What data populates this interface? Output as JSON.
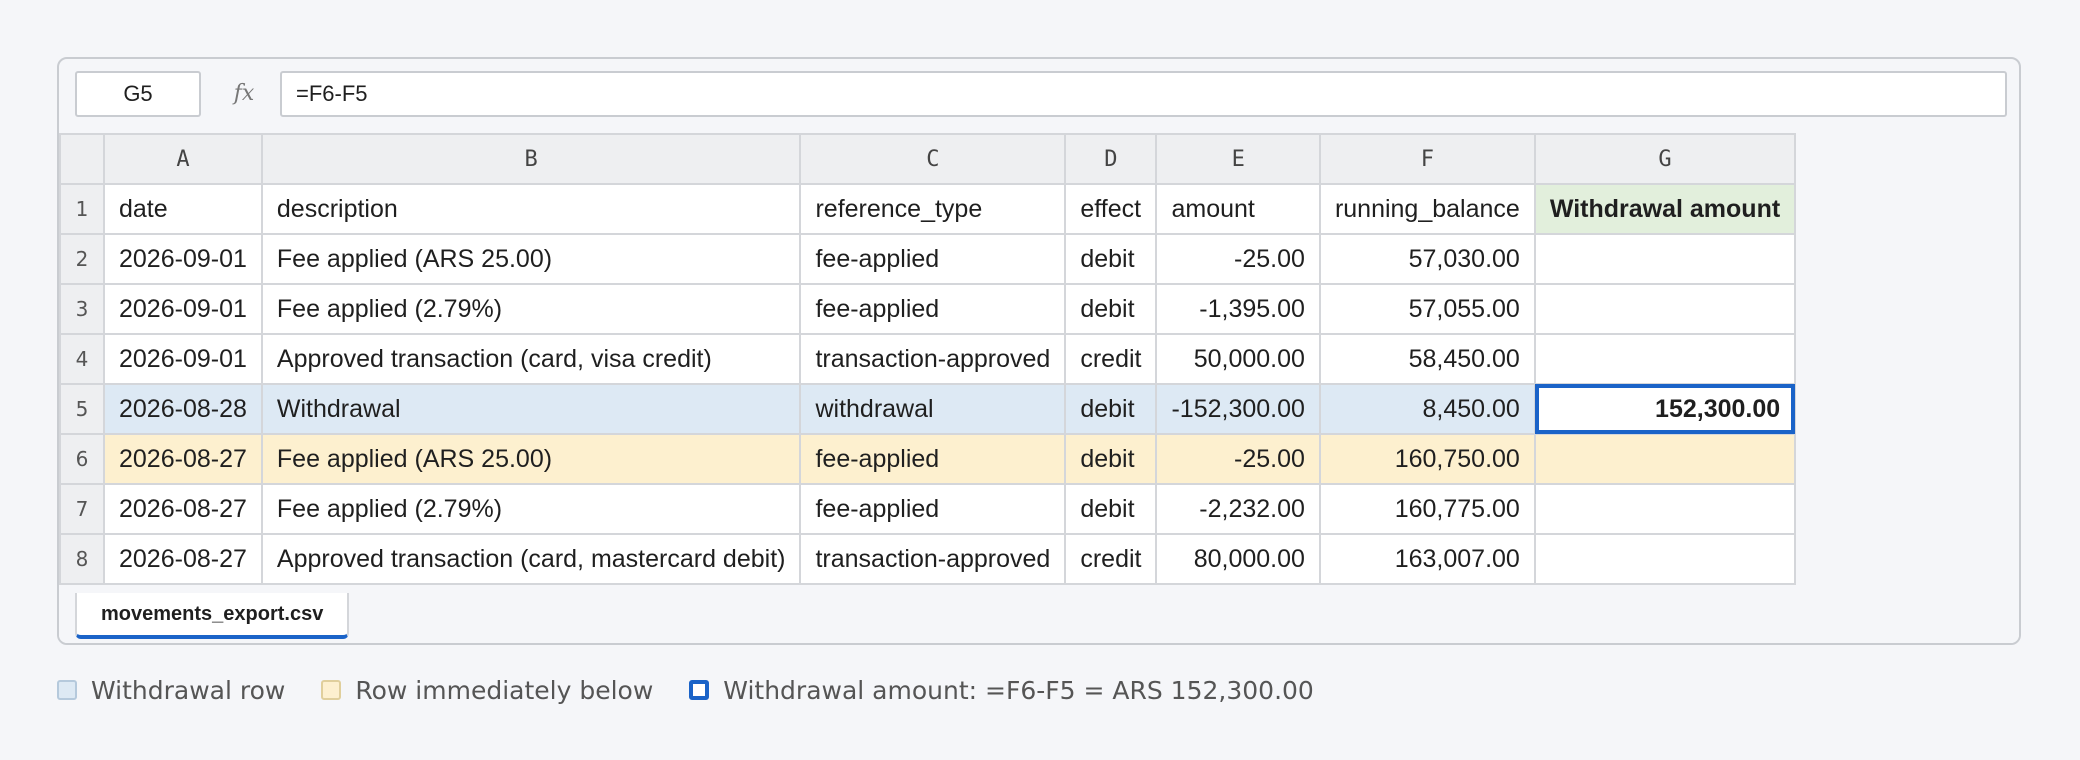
{
  "formula_bar": {
    "name_box": "G5",
    "fx_label": "fx",
    "formula": "=F6-F5"
  },
  "columns": [
    "A",
    "B",
    "C",
    "D",
    "E",
    "F",
    "G"
  ],
  "rows": [
    {
      "n": "1",
      "cells": [
        "date",
        "description",
        "reference_type",
        "effect",
        "amount",
        "running_balance",
        "Withdrawal amount"
      ]
    },
    {
      "n": "2",
      "cells": [
        "2026-09-01",
        "Fee applied (ARS 25.00)",
        "fee-applied",
        "debit",
        "-25.00",
        "57,030.00",
        ""
      ]
    },
    {
      "n": "3",
      "cells": [
        "2026-09-01",
        "Fee applied (2.79%)",
        "fee-applied",
        "debit",
        "-1,395.00",
        "57,055.00",
        ""
      ]
    },
    {
      "n": "4",
      "cells": [
        "2026-09-01",
        "Approved transaction (card, visa credit)",
        "transaction-approved",
        "credit",
        "50,000.00",
        "58,450.00",
        ""
      ]
    },
    {
      "n": "5",
      "cells": [
        "2026-08-28",
        "Withdrawal",
        "withdrawal",
        "debit",
        "-152,300.00",
        "8,450.00",
        "152,300.00"
      ]
    },
    {
      "n": "6",
      "cells": [
        "2026-08-27",
        "Fee applied (ARS 25.00)",
        "fee-applied",
        "debit",
        "-25.00",
        "160,750.00",
        ""
      ]
    },
    {
      "n": "7",
      "cells": [
        "2026-08-27",
        "Fee applied (2.79%)",
        "fee-applied",
        "debit",
        "-2,232.00",
        "160,775.00",
        ""
      ]
    },
    {
      "n": "8",
      "cells": [
        "2026-08-27",
        "Approved transaction (card, mastercard debit)",
        "transaction-approved",
        "credit",
        "80,000.00",
        "163,007.00",
        ""
      ]
    }
  ],
  "sheet_tab": "movements_export.csv",
  "legend": {
    "withdrawal_row": "Withdrawal row",
    "row_below": "Row immediately below",
    "formula_note": "Withdrawal amount: =F6-F5 = ARS 152,300.00"
  },
  "colors": {
    "withdrawal_row": "#dde9f4",
    "row_below": "#fdf0cf",
    "header_highlight": "#e2efdc",
    "selection": "#1a63c8"
  },
  "selected_cell": "G5"
}
